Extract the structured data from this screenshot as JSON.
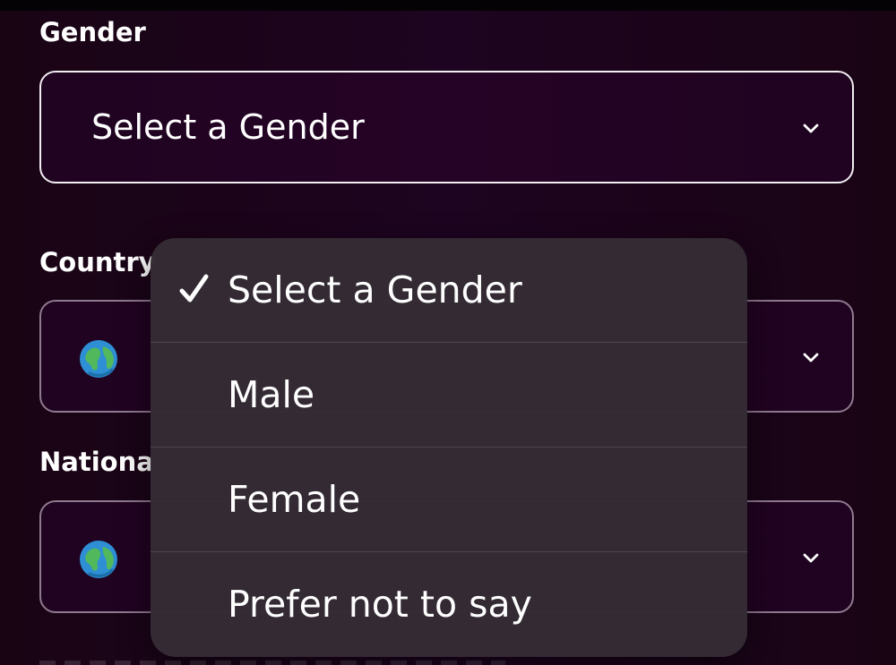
{
  "colors": {
    "background": "#1d0420",
    "select_background": "#250326",
    "menu_background": "#342b34",
    "text": "#ffffff",
    "primary_border": "#f2eef2",
    "secondary_border": "#8f7a90"
  },
  "fields": {
    "gender": {
      "label": "Gender",
      "value": "Select a Gender",
      "icon": "chevron-down-icon"
    },
    "country": {
      "label": "Country",
      "icon": "globe-emoji-icon",
      "chevron_icon": "chevron-down-icon"
    },
    "nationality": {
      "label": "Nationa",
      "icon": "globe-emoji-icon",
      "chevron_icon": "chevron-down-icon"
    }
  },
  "gender_menu": {
    "items": [
      {
        "label": "Select a Gender",
        "selected": true,
        "icon": "checkmark-icon"
      },
      {
        "label": "Male",
        "selected": false
      },
      {
        "label": "Female",
        "selected": false
      },
      {
        "label": "Prefer not to say",
        "selected": false
      }
    ]
  }
}
